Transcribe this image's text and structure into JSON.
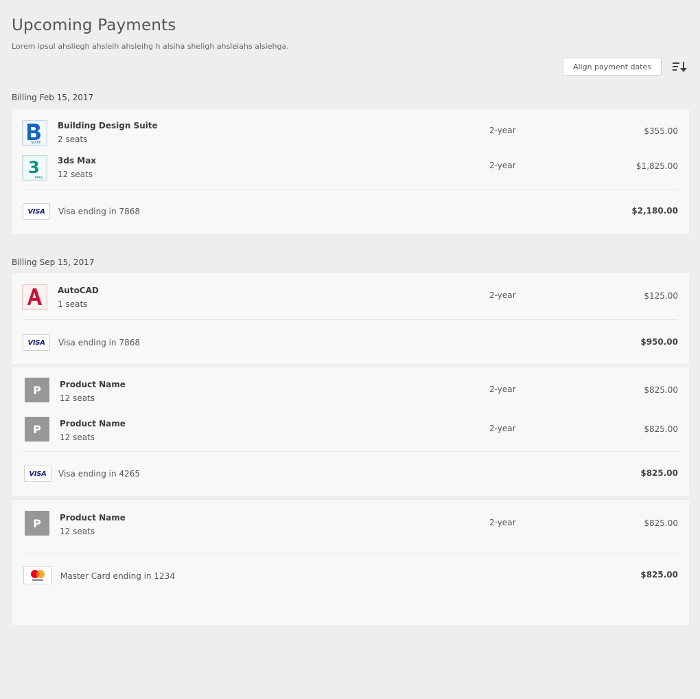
{
  "header": {
    "title": "Upcoming Payments",
    "subtitle": "Lorem ipsul ahsliegh ahsleih ahsleihg h alsiha sheligh ahsleiahs alsiehga.",
    "align_button": "Align payment dates",
    "sort_icon": "sort-descending-icon"
  },
  "groups": [
    {
      "billing_label": "Billing Feb 15, 2017",
      "cards": [
        {
          "products": [
            {
              "name": "Building Design Suite",
              "seats": "2 seats",
              "term": "2-year",
              "price": "$355.00",
              "icon": "building-design-suite-icon"
            },
            {
              "name": "3ds Max",
              "seats": "12 seats",
              "term": "2-year",
              "price": "$1,825.00",
              "icon": "3ds-max-icon"
            }
          ],
          "payment": {
            "card_brand": "VISA",
            "text": "Visa ending in 7868",
            "total": "$2,180.00"
          }
        }
      ]
    },
    {
      "billing_label": "Billing Sep 15, 2017",
      "cards": [
        {
          "products": [
            {
              "name": "AutoCAD",
              "seats": "1 seats",
              "term": "2-year",
              "price": "$125.00",
              "icon": "autocad-icon"
            }
          ],
          "payment": {
            "card_brand": "VISA",
            "text": "Visa ending in 7868",
            "total": "$950.00"
          }
        },
        {
          "products": [
            {
              "name": "Product Name",
              "seats": "12 seats",
              "term": "2-year",
              "price": "$825.00",
              "icon_letter": "P"
            },
            {
              "name": "Product Name",
              "seats": "12 seats",
              "term": "2-year",
              "price": "$825.00",
              "icon_letter": "P"
            }
          ],
          "payment": {
            "card_brand": "VISA",
            "text": "Visa ending in 4265",
            "total": "$825.00"
          }
        },
        {
          "products": [
            {
              "name": "Product Name",
              "seats": "12 seats",
              "term": "2-year",
              "price": "$825.00",
              "icon_letter": "P"
            }
          ],
          "payment": {
            "card_brand": "mastercard",
            "text": "Master Card ending in 1234",
            "total": "$825.00"
          }
        }
      ]
    }
  ],
  "colors": {
    "background": "#eeeeee",
    "card": "#f8f8f8",
    "visa_blue": "#1a1f71",
    "mastercard_red": "#eb001b",
    "mastercard_orange": "#f79e1b",
    "autocad_red": "#c8102e",
    "bds_blue": "#1565c0",
    "max_teal": "#0a8f8a",
    "placeholder_gray": "#979797"
  }
}
